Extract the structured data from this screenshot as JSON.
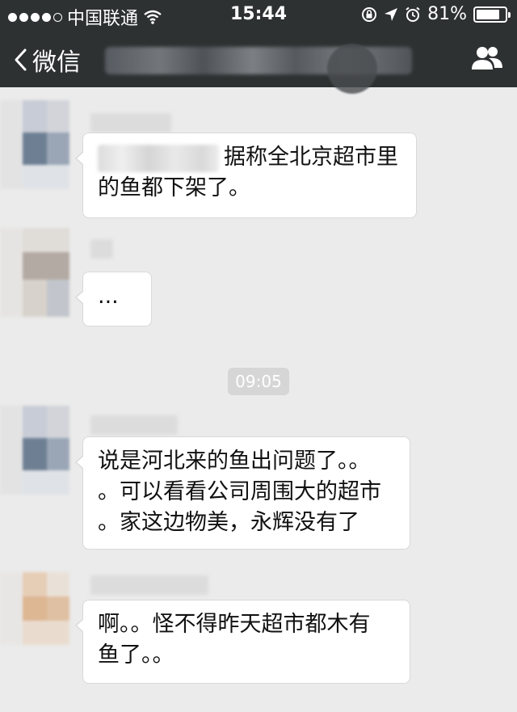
{
  "status_bar": {
    "carrier": "中国联通",
    "time": "15:44",
    "battery": "81%",
    "battery_level": 0.81
  },
  "nav": {
    "back_label": "微信"
  },
  "messages": [
    {
      "text_line1": "据称全北京超市里",
      "text_line2": "的鱼都下架了。"
    },
    {
      "text": "..."
    },
    {
      "text_line1": "说是河北来的鱼出问题了。。",
      "text_line2": "。可以看看公司周围大的超市",
      "text_line3": "。家这边物美，永辉没有了"
    },
    {
      "text_line1": "啊。。怪不得昨天超市都木有",
      "text_line2": "鱼了。。"
    }
  ],
  "time_divider": "09:05",
  "icons": {
    "signal": "signal-dots-icon",
    "wifi": "wifi-icon",
    "lock": "rotation-lock-icon",
    "location": "location-arrow-icon",
    "alarm": "alarm-clock-icon",
    "battery": "battery-icon",
    "back": "chevron-left-icon",
    "contact": "contacts-icon"
  },
  "colors": {
    "nav_bg": "#2e3132",
    "chat_bg": "#ebebeb",
    "bubble_bg": "#ffffff"
  }
}
